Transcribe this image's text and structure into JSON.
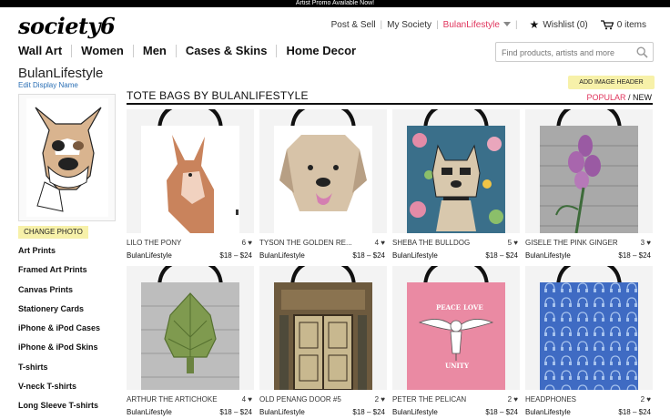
{
  "promo": "Artist Promo Available Now!",
  "logo": "society6",
  "topnav": {
    "post_sell": "Post & Sell",
    "my_society": "My Society",
    "user": "BulanLifestyle",
    "wishlist": "Wishlist (0)",
    "cart": "0 items"
  },
  "mainnav": [
    "Wall Art",
    "Women",
    "Men",
    "Cases & Skins",
    "Home Decor"
  ],
  "search": {
    "placeholder": "Find products, artists and more"
  },
  "profile": {
    "name": "BulanLifestyle",
    "edit": "Edit Display Name",
    "add_header": "ADD IMAGE HEADER",
    "change_photo": "CHANGE PHOTO"
  },
  "sidebar": [
    "Art Prints",
    "Framed Art Prints",
    "Canvas Prints",
    "Stationery Cards",
    "iPhone & iPod Cases",
    "iPhone & iPod Skins",
    "T-shirts",
    "V-neck T-shirts",
    "Long Sleeve T-shirts"
  ],
  "section": {
    "title": "TOTE BAGS BY BULANLIFESTYLE",
    "popular": "POPULAR",
    "slash": " / ",
    "new": "NEW"
  },
  "products": [
    {
      "title": "LILO THE PONY",
      "likes": "6",
      "artist": "BulanLifestyle",
      "price": "$18 – $24",
      "design": "pony"
    },
    {
      "title": "TYSON THE GOLDEN RE...",
      "likes": "4",
      "artist": "BulanLifestyle",
      "price": "$18 – $24",
      "design": "retriever"
    },
    {
      "title": "SHEBA THE BULLDOG",
      "likes": "5",
      "artist": "BulanLifestyle",
      "price": "$18 – $24",
      "design": "bulldog"
    },
    {
      "title": "GISELE THE PINK GINGER",
      "likes": "3",
      "artist": "BulanLifestyle",
      "price": "$18 – $24",
      "design": "ginger"
    },
    {
      "title": "ARTHUR THE ARTICHOKE",
      "likes": "4",
      "artist": "BulanLifestyle",
      "price": "$18 – $24",
      "design": "artichoke"
    },
    {
      "title": "OLD PENANG DOOR #5",
      "likes": "2",
      "artist": "BulanLifestyle",
      "price": "$18 – $24",
      "design": "door"
    },
    {
      "title": "PETER THE PELICAN",
      "likes": "2",
      "artist": "BulanLifestyle",
      "price": "$18 – $24",
      "design": "pelican",
      "art_text": [
        "PEACE",
        "LOVE",
        "UNITY"
      ]
    },
    {
      "title": "HEADPHONES",
      "likes": "2",
      "artist": "BulanLifestyle",
      "price": "$18 – $24",
      "design": "headphones"
    }
  ],
  "colors": {
    "accent": "#e0355d",
    "highlight": "#f7f1a9",
    "link": "#2a6fb5"
  }
}
